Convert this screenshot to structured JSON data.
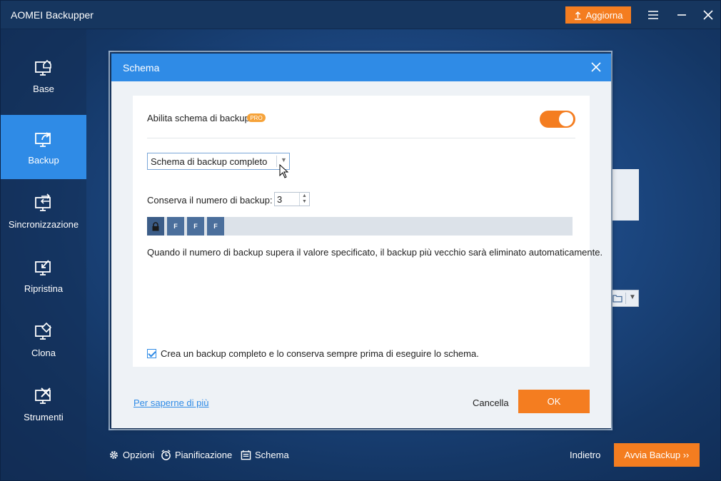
{
  "app": {
    "title": "AOMEI Backupper",
    "upgrade_label": "Aggiorna"
  },
  "colors": {
    "accent": "#2f8be6",
    "orange": "#f47d20",
    "titlebar": "#16365f"
  },
  "sidebar": {
    "items": [
      {
        "label": "Base",
        "icon": "home-monitor-icon",
        "active": false
      },
      {
        "label": "Backup",
        "icon": "backup-monitor-icon",
        "active": true
      },
      {
        "label": "Sincronizzazione",
        "icon": "sync-monitor-icon",
        "active": false
      },
      {
        "label": "Ripristina",
        "icon": "restore-monitor-icon",
        "active": false
      },
      {
        "label": "Clona",
        "icon": "clone-monitor-icon",
        "active": false
      },
      {
        "label": "Strumenti",
        "icon": "tools-monitor-icon",
        "active": false
      }
    ]
  },
  "bottom": {
    "options_label": "Opzioni",
    "schedule_label": "Pianificazione",
    "scheme_label": "Schema",
    "back_label": "Indietro",
    "start_label": "Avvia Backup ››"
  },
  "dialog": {
    "title": "Schema",
    "enable_label": "Abilita schema di backup",
    "pro_badge": "PRO",
    "enabled": true,
    "scheme_value": "Schema di backup completo",
    "keep_label": "Conserva il numero di backup:",
    "keep_value": "3",
    "bar_cells": [
      "F",
      "F",
      "F"
    ],
    "description": "Quando il numero di backup supera il valore specificato, il backup più vecchio sarà eliminato automaticamente.",
    "checkbox_label": "Crea un backup completo e lo conserva sempre prima di eseguire lo schema.",
    "checkbox_checked": true,
    "learn_more": "Per saperne di più",
    "cancel_label": "Cancella",
    "ok_label": "OK"
  }
}
